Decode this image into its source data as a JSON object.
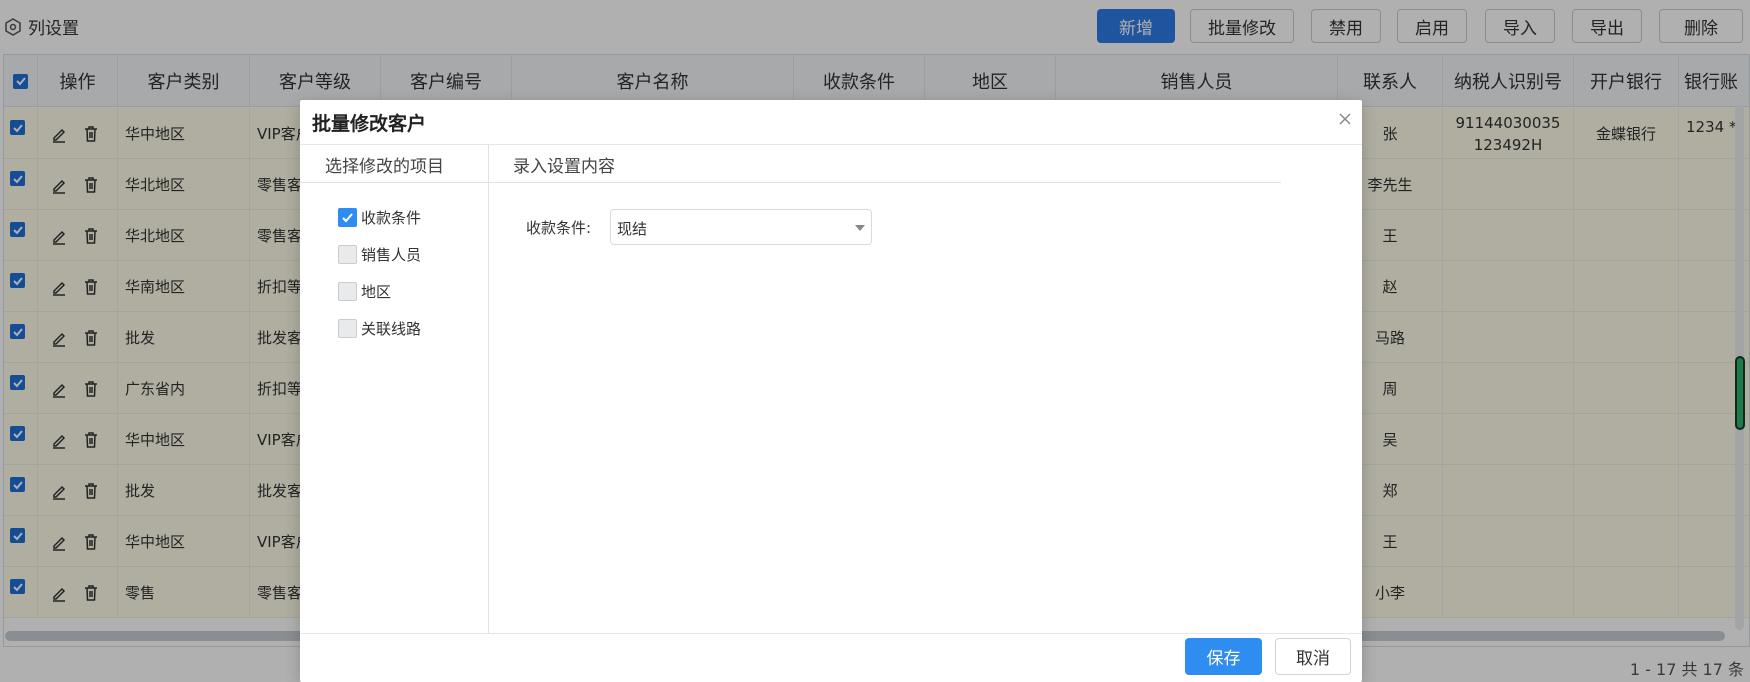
{
  "toolbar": {
    "column_settings": "列设置",
    "buttons": [
      {
        "label": "新增",
        "primary": true
      },
      {
        "label": "批量修改",
        "primary": false
      },
      {
        "label": "禁用",
        "primary": false
      },
      {
        "label": "启用",
        "primary": false
      },
      {
        "label": "导入",
        "primary": false
      },
      {
        "label": "导出",
        "primary": false
      },
      {
        "label": "删除",
        "primary": false
      }
    ]
  },
  "table": {
    "headers": [
      "操作",
      "客户类别",
      "客户等级",
      "客户编号",
      "客户名称",
      "收款条件",
      "地区",
      "销售人员",
      "联系人",
      "纳税人识别号",
      "开户银行",
      "银行账"
    ],
    "rows": [
      {
        "category": "华中地区",
        "level": "VIP客户",
        "contact": "张",
        "tax_id": "91144030035123492H",
        "bank": "金蝶银行",
        "account": "1234 *"
      },
      {
        "category": "华北地区",
        "level": "零售客户",
        "contact": "李先生",
        "tax_id": "",
        "bank": "",
        "account": ""
      },
      {
        "category": "华北地区",
        "level": "零售客户",
        "contact": "王",
        "tax_id": "",
        "bank": "",
        "account": ""
      },
      {
        "category": "华南地区",
        "level": "折扣等级",
        "contact": "赵",
        "tax_id": "",
        "bank": "",
        "account": ""
      },
      {
        "category": "批发",
        "level": "批发客户",
        "contact": "马路",
        "tax_id": "",
        "bank": "",
        "account": ""
      },
      {
        "category": "广东省内",
        "level": "折扣等级",
        "contact": "周",
        "tax_id": "",
        "bank": "",
        "account": ""
      },
      {
        "category": "华中地区",
        "level": "VIP客户",
        "contact": "吴",
        "tax_id": "",
        "bank": "",
        "account": ""
      },
      {
        "category": "批发",
        "level": "批发客户",
        "contact": "郑",
        "tax_id": "",
        "bank": "",
        "account": ""
      },
      {
        "category": "华中地区",
        "level": "VIP客户",
        "contact": "王",
        "tax_id": "",
        "bank": "",
        "account": ""
      },
      {
        "category": "零售",
        "level": "零售客户",
        "contact": "小李",
        "tax_id": "",
        "bank": "",
        "account": ""
      }
    ],
    "pager": "1 - 17    共 17 条"
  },
  "modal": {
    "title": "批量修改客户",
    "left_title": "选择修改的项目",
    "right_title": "录入设置内容",
    "options": [
      {
        "label": "收款条件",
        "checked": true
      },
      {
        "label": "销售人员",
        "checked": false
      },
      {
        "label": "地区",
        "checked": false
      },
      {
        "label": "关联线路",
        "checked": false
      }
    ],
    "field": {
      "label": "收款条件:",
      "value": "现结"
    },
    "save": "保存",
    "cancel": "取消"
  }
}
